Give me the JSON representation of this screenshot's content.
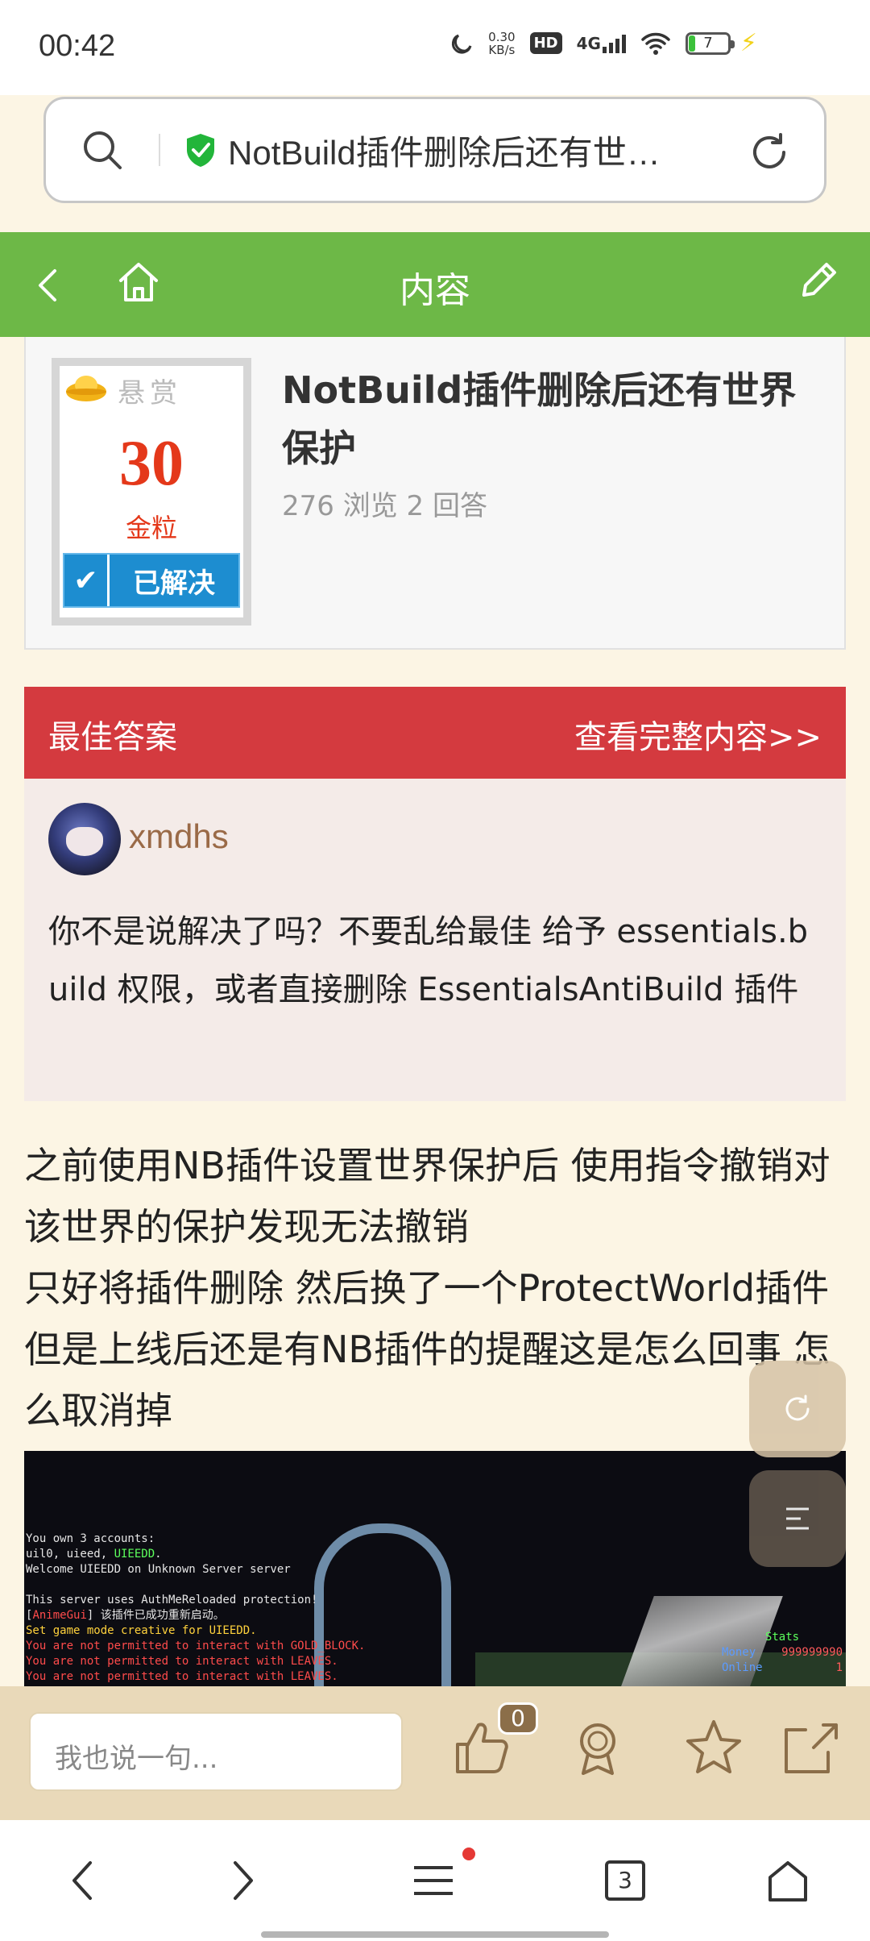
{
  "status": {
    "time": "00:42",
    "net_speed_value": "0.30",
    "net_speed_unit": "KB/s",
    "hd": "HD",
    "network": "4G",
    "battery": "7"
  },
  "urlbar": {
    "url_text": "NotBuild插件删除后还有世…"
  },
  "header": {
    "title": "内容"
  },
  "question": {
    "reward_label": "悬赏",
    "reward_amount": "30",
    "reward_unit": "金粒",
    "solved_label": "已解决",
    "title": "NotBuild插件删除后还有世界保护",
    "meta": "276 浏览  2 回答",
    "body_lines": [
      "之前使用NB插件设置世界保护后 使用指令撤销对该世界的保护发现无法撤销",
      "只好将插件删除 然后换了一个ProtectWorld插件 但是上线后还是有NB插件的提醒这是怎么回事 怎么取消掉"
    ]
  },
  "best_answer": {
    "label": "最佳答案",
    "view_full": "查看完整内容>>",
    "username": "xmdhs",
    "content": "你不是说解决了吗？不要乱给最佳 给予 essentials.build 权限，或者直接删除 EssentialsAntiBuild 插件"
  },
  "screenshot": {
    "lines": [
      [
        "You own 3 accounts:"
      ],
      [
        "uil0, uieed, ",
        "UIEEDD",
        "."
      ],
      [
        "Welcome UIEEDD on Unknown Server server"
      ],
      [
        ""
      ],
      [
        "This server uses AuthMeReloaded protection!"
      ],
      [
        "[",
        "AnimeGui",
        "] 该插件已成功重新启动。"
      ],
      [
        "Set game mode creative for UIEEDD."
      ],
      [
        "You are not permitted to interact with GOLD_BLOCK."
      ],
      [
        "You are not permitted to interact with LEAVES."
      ],
      [
        "You are not permitted to interact with LEAVES."
      ]
    ],
    "stats_title": "Stats",
    "stats": [
      {
        "k": "Money",
        "v": "999999990"
      },
      {
        "k": "Online",
        "v": "1"
      }
    ]
  },
  "comment_bar": {
    "placeholder": "我也说一句...",
    "like_count": "0"
  },
  "bottom_nav": {
    "tab_count": "3"
  },
  "icons": [
    "search-icon",
    "shield-check-icon",
    "reload-icon",
    "back-icon",
    "home-icon",
    "edit-icon",
    "gold-ingot-icon",
    "check-icon",
    "refresh-icon",
    "toc-icon",
    "thumb-up-icon",
    "award-icon",
    "star-icon",
    "share-icon",
    "back-arrow-icon",
    "forward-arrow-icon",
    "menu-icon",
    "tabs-icon",
    "home-nav-icon"
  ],
  "colors": {
    "header_green": "#6db847",
    "best_answer_red": "#d43a3f",
    "reward_red": "#e4381a",
    "solved_blue": "#1d8dd0",
    "page_bg": "#fcf5e4",
    "comment_bar": "#e9d9b9"
  }
}
